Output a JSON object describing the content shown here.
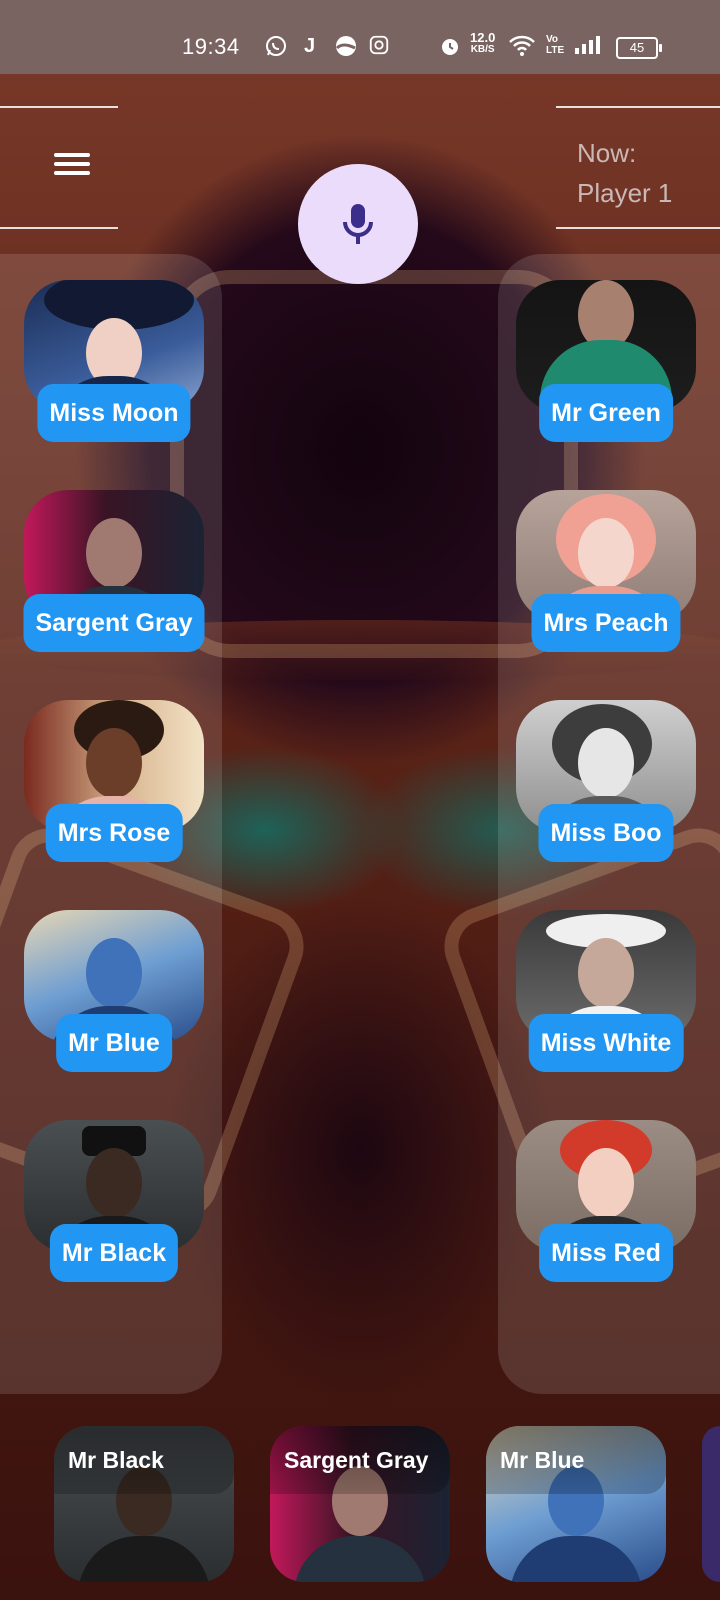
{
  "status_bar": {
    "time": "19:34",
    "speed_value": "12.0",
    "speed_unit": "KB/S",
    "volte": "Vo LTE",
    "battery": "45",
    "icons": [
      "whatsapp-icon",
      "j-app-icon",
      "pie-app-icon",
      "instagram-icon",
      "alarm-icon",
      "wifi-icon",
      "signal-icon",
      "battery-icon"
    ]
  },
  "header": {
    "menu_icon": "hamburger-menu-icon",
    "mic_icon": "microphone-icon",
    "now_label": "Now:",
    "now_player": "Player 1"
  },
  "characters_left": [
    {
      "name": "Miss Moon"
    },
    {
      "name": "Sargent Gray"
    },
    {
      "name": "Mrs Rose"
    },
    {
      "name": "Mr Blue"
    },
    {
      "name": "Mr Black"
    }
  ],
  "characters_right": [
    {
      "name": "Mr Green"
    },
    {
      "name": "Mrs Peach"
    },
    {
      "name": "Miss Boo"
    },
    {
      "name": "Miss White"
    },
    {
      "name": "Miss Red"
    }
  ],
  "bottom_tray": [
    {
      "name": "Mr Black"
    },
    {
      "name": "Sargent Gray"
    },
    {
      "name": "Mr Blue"
    }
  ],
  "colors": {
    "accent_button": "#2196f3",
    "mic_button": "#ecdcfb",
    "mic_icon": "#3b2e8a",
    "status_bar": "#7a6461"
  }
}
